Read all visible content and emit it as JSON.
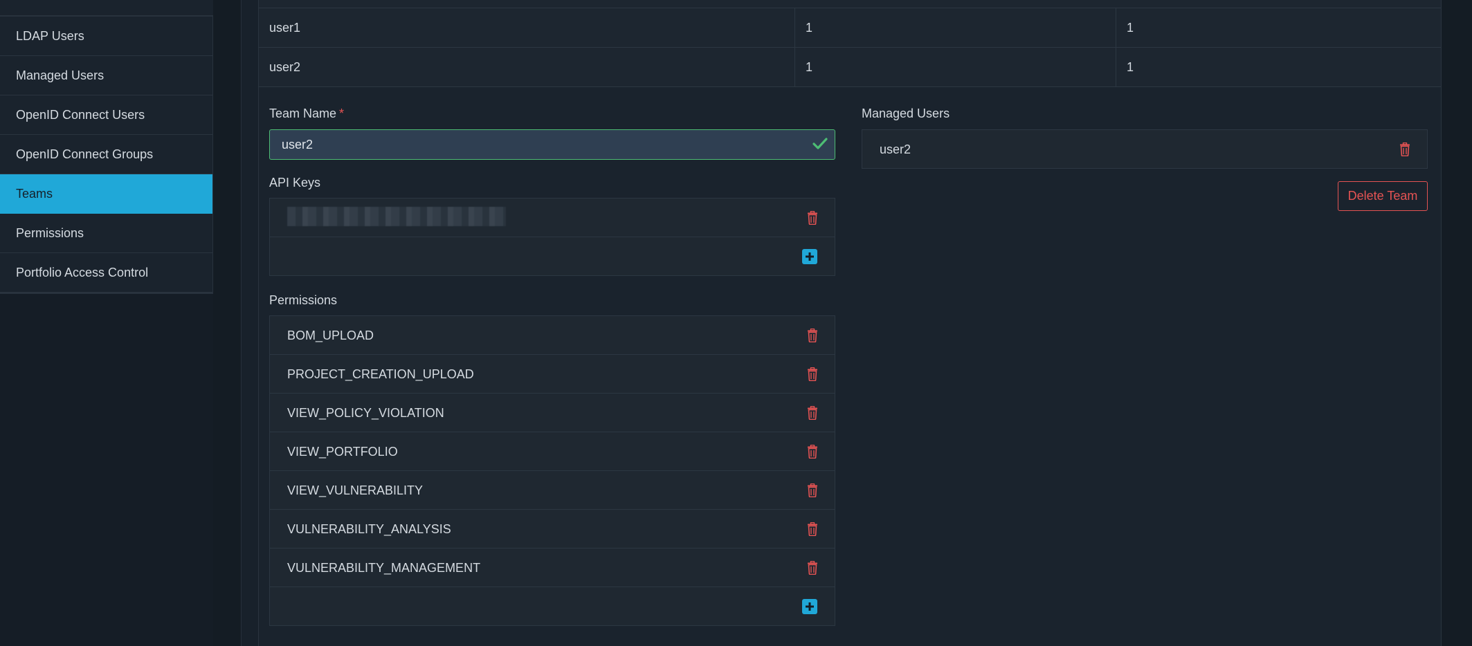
{
  "sidebar": {
    "items": [
      {
        "label": "LDAP Users",
        "active": false
      },
      {
        "label": "Managed Users",
        "active": false
      },
      {
        "label": "OpenID Connect Users",
        "active": false
      },
      {
        "label": "OpenID Connect Groups",
        "active": false
      },
      {
        "label": "Teams",
        "active": true
      },
      {
        "label": "Permissions",
        "active": false
      },
      {
        "label": "Portfolio Access Control",
        "active": false
      }
    ]
  },
  "table": {
    "rows": [
      [
        "user1",
        "1",
        "1"
      ],
      [
        "user2",
        "1",
        "1"
      ]
    ]
  },
  "team_form": {
    "team_name_label": "Team Name",
    "required_mark": "*",
    "team_name_value": "user2",
    "api_keys_label": "API Keys",
    "permissions_label": "Permissions",
    "permissions": [
      "BOM_UPLOAD",
      "PROJECT_CREATION_UPLOAD",
      "VIEW_POLICY_VIOLATION",
      "VIEW_PORTFOLIO",
      "VIEW_VULNERABILITY",
      "VULNERABILITY_ANALYSIS",
      "VULNERABILITY_MANAGEMENT"
    ],
    "managed_users_label": "Managed Users",
    "managed_users": [
      "user2"
    ],
    "delete_team_label": "Delete Team"
  },
  "colors": {
    "accent": "#20a8d8",
    "danger": "#e55353",
    "success": "#4dbd74"
  },
  "icons": {
    "valid": "check-icon",
    "remove": "trash-icon",
    "add": "plus-square-icon"
  }
}
